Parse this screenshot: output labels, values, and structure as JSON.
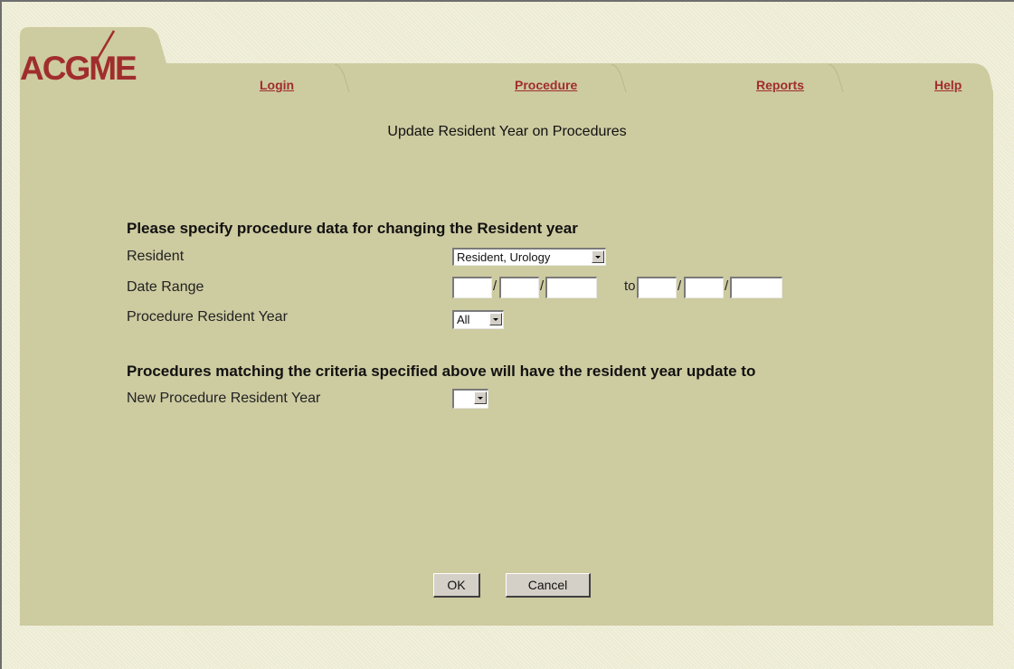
{
  "logo": {
    "text": "ACGME"
  },
  "tabs": [
    {
      "label": "Login"
    },
    {
      "label": "Procedure"
    },
    {
      "label": "Reports"
    },
    {
      "label": "Help"
    }
  ],
  "page": {
    "title": "Update Resident Year on Procedures"
  },
  "criteria": {
    "heading": "Please specify procedure data for changing the Resident year",
    "resident_label": "Resident",
    "resident_value": "Resident, Urology",
    "date_range_label": "Date Range",
    "date_separator": "/",
    "date_to": "to",
    "proc_year_label": "Procedure Resident Year",
    "proc_year_value": "All"
  },
  "update": {
    "heading": "Procedures matching the criteria specified above will have the resident year update to",
    "new_year_label": "New Procedure Resident Year",
    "new_year_value": ""
  },
  "buttons": {
    "ok": "OK",
    "cancel": "Cancel"
  },
  "colors": {
    "panel": "#cdcba0",
    "link": "#a02d2d",
    "background": "#ecebd2"
  }
}
